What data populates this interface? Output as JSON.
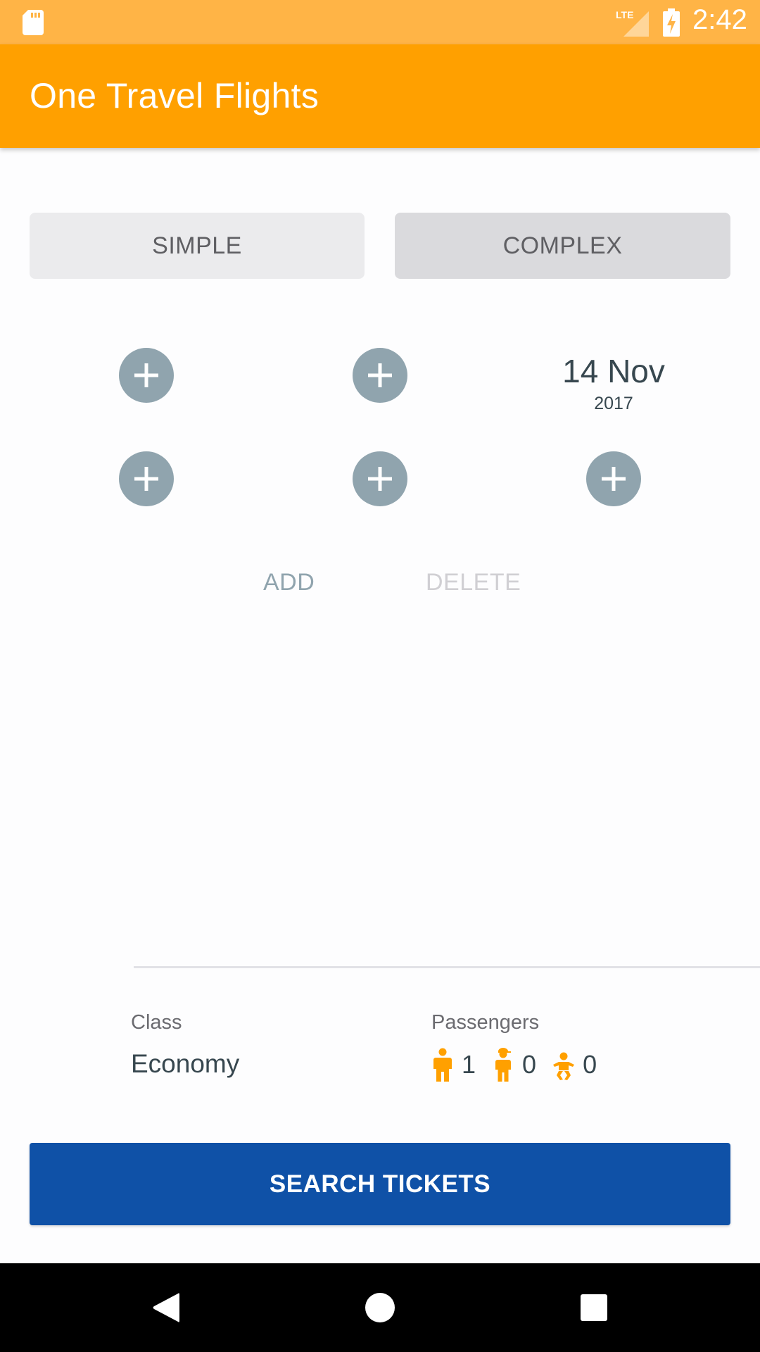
{
  "status_bar": {
    "time": "2:42",
    "network": "LTE",
    "icons": [
      "sd-card-icon",
      "lte-signal-icon",
      "battery-charging-icon"
    ]
  },
  "app_bar": {
    "title": "One Travel Flights",
    "color": "#ffa000"
  },
  "mode_tabs": [
    {
      "label": "SIMPLE",
      "selected": false
    },
    {
      "label": "COMPLEX",
      "selected": true
    }
  ],
  "segments": [
    {
      "from_icon": "plus-icon",
      "to_icon": "plus-icon",
      "date": {
        "day_month": "14 Nov",
        "year": "2017"
      }
    },
    {
      "from_icon": "plus-icon",
      "to_icon": "plus-icon",
      "date_icon": "plus-icon"
    }
  ],
  "segment_actions": {
    "add_label": "ADD",
    "delete_label": "DELETE",
    "delete_enabled": false
  },
  "class_field": {
    "label": "Class",
    "value": "Economy"
  },
  "passengers_field": {
    "label": "Passengers",
    "adults": {
      "icon": "adult-icon",
      "count": "1"
    },
    "children": {
      "icon": "child-icon",
      "count": "0"
    },
    "infants": {
      "icon": "infant-icon",
      "count": "0"
    },
    "icon_color": "#ffa000"
  },
  "search_button": {
    "label": "SEARCH TICKETS",
    "color": "#0f51a7"
  },
  "nav_bar": {
    "buttons": [
      "back-icon",
      "home-icon",
      "recents-icon"
    ]
  }
}
